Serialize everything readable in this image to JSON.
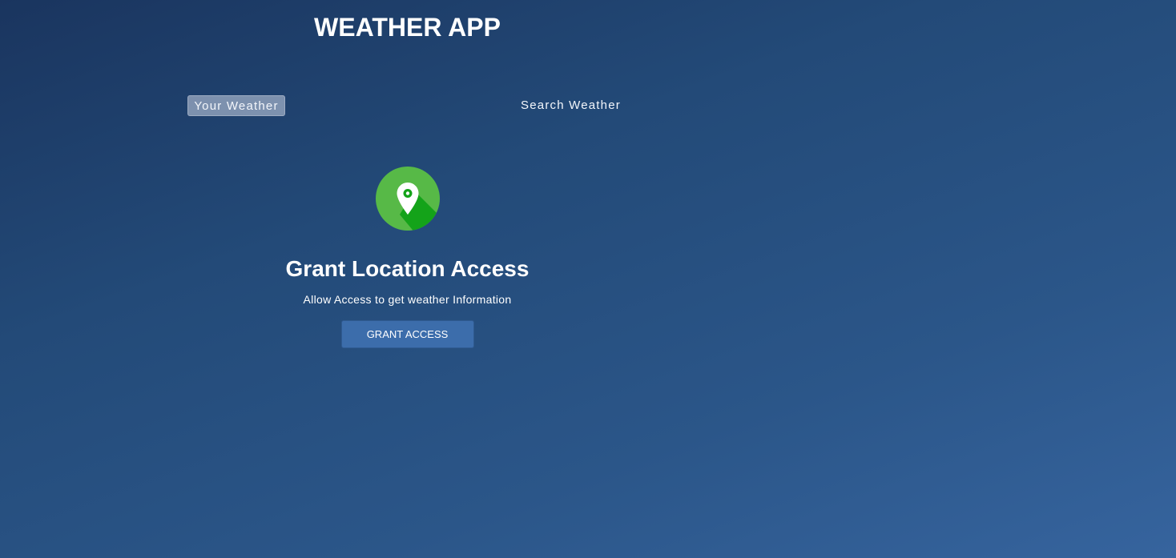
{
  "app": {
    "title": "WEATHER APP"
  },
  "tabs": [
    {
      "label": "Your Weather",
      "active": true
    },
    {
      "label": "Search Weather",
      "active": false
    }
  ],
  "grant": {
    "icon": "location-pin-icon",
    "heading": "Grant Location Access",
    "subtitle": "Allow Access to get weather Information",
    "button_label": "GRANT ACCESS"
  },
  "colors": {
    "background_start": "#1a355f",
    "background_end": "#36649e",
    "icon_green": "#57b947",
    "icon_shadow_green": "#14a319",
    "button_blue": "#3c6dab"
  }
}
